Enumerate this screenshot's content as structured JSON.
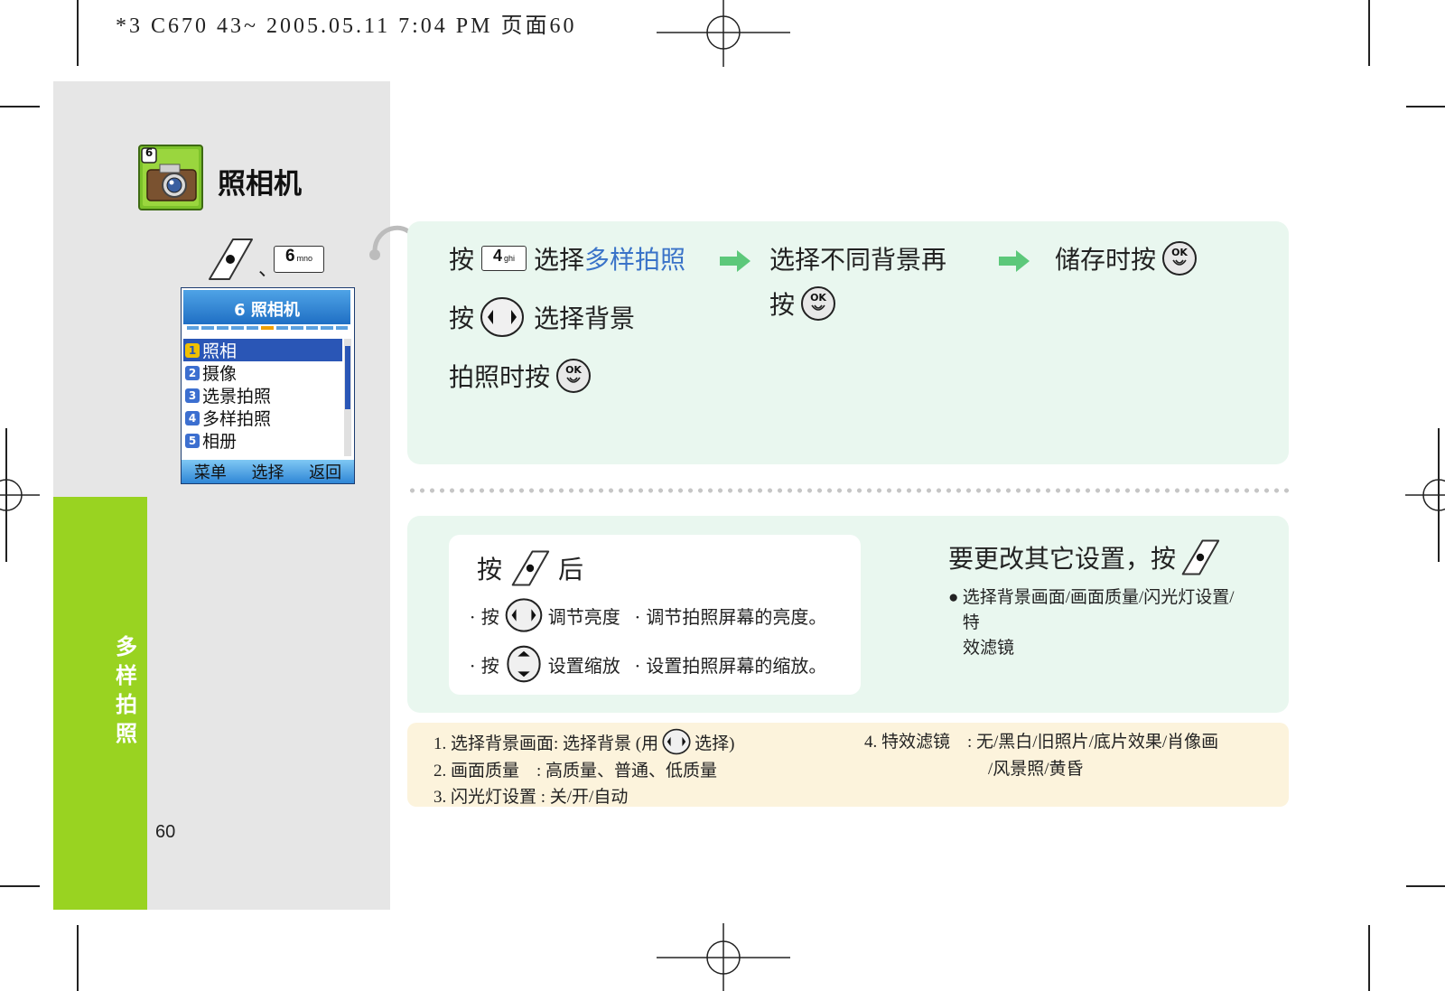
{
  "print_header": "*3 C670 43~ 2005.05.11 7:04 PM 页面60",
  "section_title": "照相机",
  "camera_badge": "6",
  "shortcut": {
    "separator": "、",
    "key_main": "6",
    "key_sub": "mno"
  },
  "phone": {
    "title": "6 照相机",
    "items": [
      {
        "num": "1",
        "label": "照相"
      },
      {
        "num": "2",
        "label": "摄像"
      },
      {
        "num": "3",
        "label": "选景拍照"
      },
      {
        "num": "4",
        "label": "多样拍照"
      },
      {
        "num": "5",
        "label": "相册"
      }
    ],
    "softkeys": [
      "菜单",
      "选择",
      "返回"
    ]
  },
  "side_label": "多样拍照",
  "page_number": "60",
  "steps": {
    "s1_pre": "按",
    "key4_main": "4",
    "key4_sub": "ghi",
    "s1_mid": "选择",
    "s1_highlight": "多样拍照",
    "s1_line2_pre": "按",
    "s1_line2_post": "选择背景",
    "s1_line3": "拍照时按",
    "s2_line1": "选择不同背景再",
    "s2_line2": "按",
    "s3_line1": "储存时按",
    "ok_label": "OK"
  },
  "press_panel": {
    "head_pre": "按",
    "head_post": "后",
    "row1_pre": "· 按",
    "row1_action": "调节亮度",
    "row1_desc": "· 调节拍照屏幕的亮度。",
    "row2_pre": "· 按",
    "row2_action": "设置缩放",
    "row2_desc": "· 设置拍照屏幕的缩放。"
  },
  "other_settings": {
    "head": "要更改其它设置，按",
    "bullet_line1": "选择背景画面/画面质量/闪光灯设置/特",
    "bullet_line2": "效滤镜"
  },
  "notes": {
    "n1_pre": "1. 选择背景画面: 选择背景 (用",
    "n1_post": "选择)",
    "n2": "2. 画面质量　: 高质量、普通、低质量",
    "n3": "3. 闪光灯设置 : 关/开/自动",
    "n4_line1": "4. 特效滤镜　: 无/黑白/旧照片/底片效果/肖像画",
    "n4_line2": "/风景照/黄昏"
  },
  "colors": {
    "left_gray": "#e6e6e6",
    "side_green": "#99d321",
    "panel_green": "#e9f7ef",
    "panel_cream": "#fcf3dc",
    "highlight_blue": "#3a73c8",
    "arrow_green": "#5cc87a"
  }
}
